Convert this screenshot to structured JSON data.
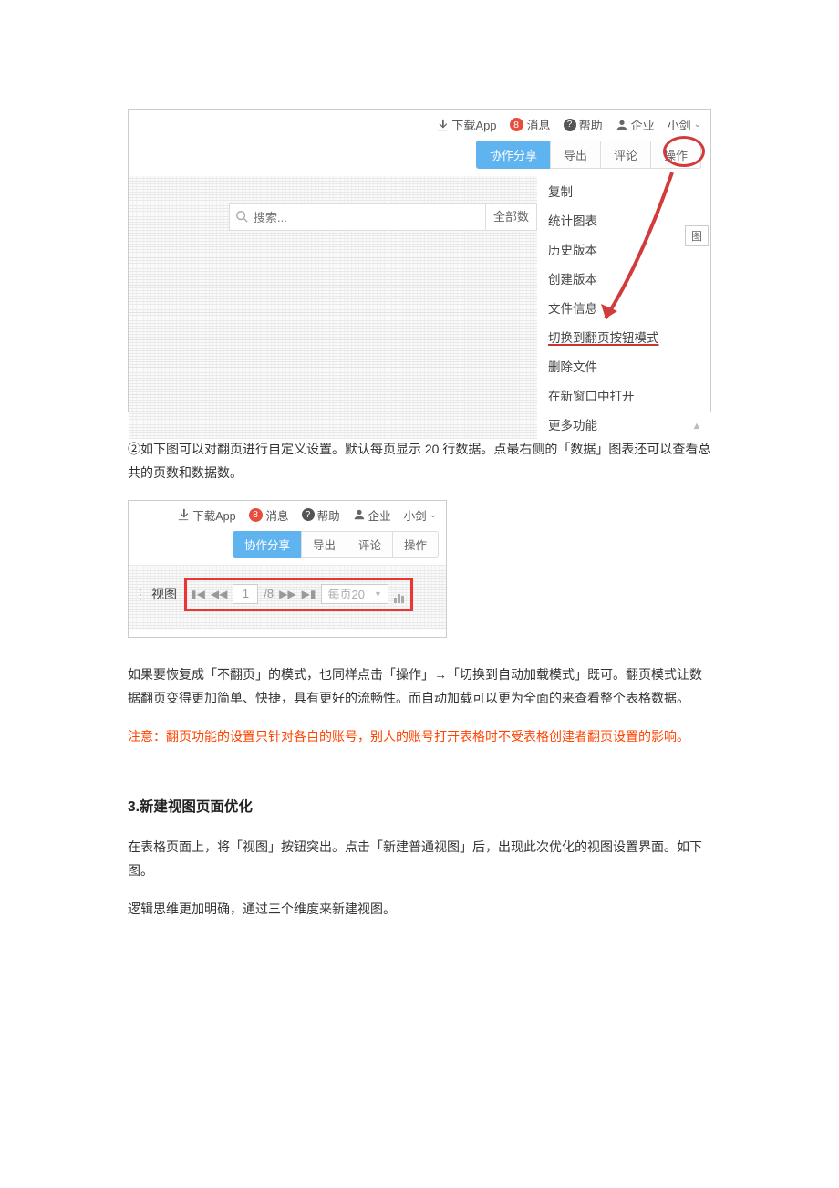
{
  "fig1": {
    "top": {
      "download": "下载App",
      "msg_badge": "8",
      "msg": "消息",
      "help": "帮助",
      "enterprise": "企业",
      "user": "小剑"
    },
    "toolbar": {
      "share": "协作分享",
      "export": "导出",
      "comment": "评论",
      "action": "操作"
    },
    "search": {
      "placeholder": "搜索...",
      "all": "全部数"
    },
    "dropdown": {
      "copy": "复制",
      "chart": "统计图表",
      "history": "历史版本",
      "create": "创建版本",
      "info": "文件信息",
      "switch": "切换到翻页按钮模式",
      "delete": "删除文件",
      "newwin": "在新窗口中打开",
      "more": "更多功能"
    },
    "right": {
      "tu": "图"
    }
  },
  "paras": {
    "p1": "②如下图可以对翻页进行自定义设置。默认每页显示 20 行数据。点最右侧的「数据」图表还可以查看总共的页数和数据数。",
    "p2": "如果要恢复成「不翻页」的模式，也同样点击「操作」→「切换到自动加载模式」既可。翻页模式让数据翻页变得更加简单、快捷，具有更好的流畅性。而自动加载可以更为全面的来查看整个表格数据。",
    "p3": "注意：翻页功能的设置只针对各自的账号，别人的账号打开表格时不受表格创建者翻页设置的影响。",
    "h3": "3.新建视图页面优化",
    "p4": "在表格页面上，将「视图」按钮突出。点击「新建普通视图」后，出现此次优化的视图设置界面。如下图。",
    "p5": "逻辑思维更加明确，通过三个维度来新建视图。"
  },
  "fig2": {
    "top": {
      "download": "下载App",
      "msg_badge": "8",
      "msg": "消息",
      "help": "帮助",
      "enterprise": "企业",
      "user": "小剑"
    },
    "toolbar": {
      "share": "协作分享",
      "export": "导出",
      "comment": "评论",
      "action": "操作"
    },
    "pager": {
      "view_label": "视图",
      "page": "1",
      "total": "/8",
      "per_page": "每页20"
    }
  }
}
